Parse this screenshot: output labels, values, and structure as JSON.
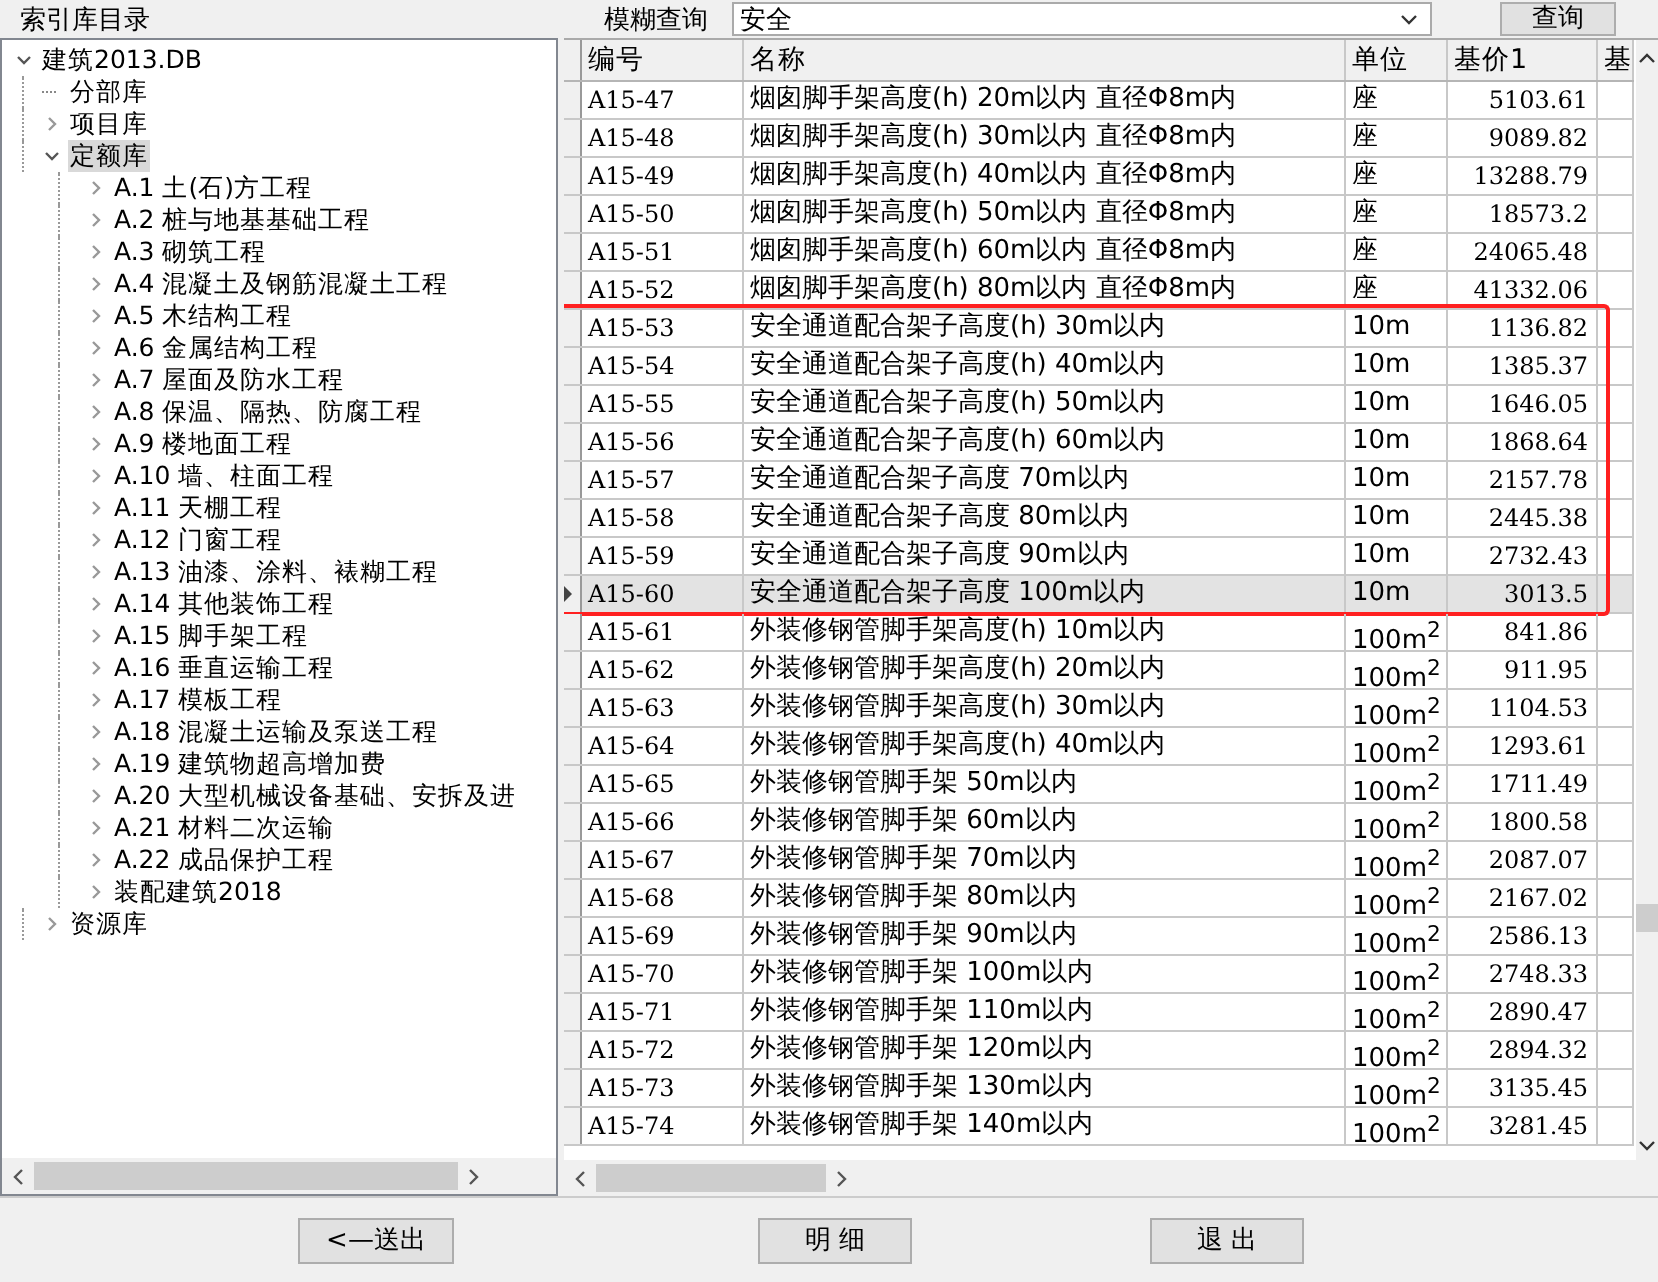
{
  "top_bar": {
    "panel_title": "索引库目录",
    "search_label": "模糊查询",
    "search_value": "安全",
    "search_button": "查询"
  },
  "tree": [
    {
      "label": "建筑2013.DB",
      "kind": "folder",
      "expanded": true,
      "selected": false,
      "children": [
        {
          "label": "分部库",
          "kind": "leaf",
          "selected": false
        },
        {
          "label": "项目库",
          "kind": "folder",
          "expanded": false,
          "selected": false
        },
        {
          "label": "定额库",
          "kind": "folder",
          "expanded": true,
          "selected": true,
          "children": [
            {
              "label": "A.1 土(石)方工程",
              "kind": "folder",
              "expanded": false,
              "selected": false
            },
            {
              "label": "A.2 桩与地基基础工程",
              "kind": "folder",
              "expanded": false,
              "selected": false
            },
            {
              "label": "A.3 砌筑工程",
              "kind": "folder",
              "expanded": false,
              "selected": false
            },
            {
              "label": "A.4 混凝土及钢筋混凝土工程",
              "kind": "folder",
              "expanded": false,
              "selected": false
            },
            {
              "label": "A.5 木结构工程",
              "kind": "folder",
              "expanded": false,
              "selected": false
            },
            {
              "label": "A.6 金属结构工程",
              "kind": "folder",
              "expanded": false,
              "selected": false
            },
            {
              "label": "A.7 屋面及防水工程",
              "kind": "folder",
              "expanded": false,
              "selected": false
            },
            {
              "label": "A.8 保温、隔热、防腐工程",
              "kind": "folder",
              "expanded": false,
              "selected": false
            },
            {
              "label": "A.9 楼地面工程",
              "kind": "folder",
              "expanded": false,
              "selected": false
            },
            {
              "label": "A.10 墙、柱面工程",
              "kind": "folder",
              "expanded": false,
              "selected": false
            },
            {
              "label": "A.11 天棚工程",
              "kind": "folder",
              "expanded": false,
              "selected": false
            },
            {
              "label": "A.12 门窗工程",
              "kind": "folder",
              "expanded": false,
              "selected": false
            },
            {
              "label": "A.13 油漆、涂料、裱糊工程",
              "kind": "folder",
              "expanded": false,
              "selected": false
            },
            {
              "label": "A.14 其他装饰工程",
              "kind": "folder",
              "expanded": false,
              "selected": false
            },
            {
              "label": "A.15 脚手架工程",
              "kind": "folder",
              "expanded": false,
              "selected": false
            },
            {
              "label": "A.16 垂直运输工程",
              "kind": "folder",
              "expanded": false,
              "selected": false
            },
            {
              "label": "A.17 模板工程",
              "kind": "folder",
              "expanded": false,
              "selected": false
            },
            {
              "label": "A.18 混凝土运输及泵送工程",
              "kind": "folder",
              "expanded": false,
              "selected": false
            },
            {
              "label": "A.19 建筑物超高增加费",
              "kind": "folder",
              "expanded": false,
              "selected": false
            },
            {
              "label": "A.20 大型机械设备基础、安拆及进",
              "kind": "folder",
              "expanded": false,
              "selected": false
            },
            {
              "label": "A.21 材料二次运输",
              "kind": "folder",
              "expanded": false,
              "selected": false
            },
            {
              "label": "A.22 成品保护工程",
              "kind": "folder",
              "expanded": false,
              "selected": false
            },
            {
              "label": "装配建筑2018",
              "kind": "folder",
              "expanded": false,
              "selected": false
            }
          ]
        },
        {
          "label": "资源库",
          "kind": "folder",
          "expanded": false,
          "selected": false
        }
      ]
    }
  ],
  "table": {
    "columns": [
      "编号",
      "名称",
      "单位",
      "基价1",
      "基"
    ],
    "rows": [
      {
        "code": "A15-47",
        "name": "烟囱脚手架高度(h) 20m以内 直径Φ8m内",
        "unit": "座",
        "price": "5103.61",
        "selected": false,
        "boxed": false
      },
      {
        "code": "A15-48",
        "name": "烟囱脚手架高度(h) 30m以内 直径Φ8m内",
        "unit": "座",
        "price": "9089.82",
        "selected": false,
        "boxed": false
      },
      {
        "code": "A15-49",
        "name": "烟囱脚手架高度(h) 40m以内 直径Φ8m内",
        "unit": "座",
        "price": "13288.79",
        "selected": false,
        "boxed": false
      },
      {
        "code": "A15-50",
        "name": "烟囱脚手架高度(h) 50m以内 直径Φ8m内",
        "unit": "座",
        "price": "18573.2",
        "selected": false,
        "boxed": false
      },
      {
        "code": "A15-51",
        "name": "烟囱脚手架高度(h) 60m以内 直径Φ8m内",
        "unit": "座",
        "price": "24065.48",
        "selected": false,
        "boxed": false
      },
      {
        "code": "A15-52",
        "name": "烟囱脚手架高度(h) 80m以内 直径Φ8m内",
        "unit": "座",
        "price": "41332.06",
        "selected": false,
        "boxed": false
      },
      {
        "code": "A15-53",
        "name": "安全通道配合架子高度(h) 30m以内",
        "unit": "10m",
        "price": "1136.82",
        "selected": false,
        "boxed": true
      },
      {
        "code": "A15-54",
        "name": "安全通道配合架子高度(h) 40m以内",
        "unit": "10m",
        "price": "1385.37",
        "selected": false,
        "boxed": true
      },
      {
        "code": "A15-55",
        "name": "安全通道配合架子高度(h) 50m以内",
        "unit": "10m",
        "price": "1646.05",
        "selected": false,
        "boxed": true
      },
      {
        "code": "A15-56",
        "name": "安全通道配合架子高度(h) 60m以内",
        "unit": "10m",
        "price": "1868.64",
        "selected": false,
        "boxed": true
      },
      {
        "code": "A15-57",
        "name": "安全通道配合架子高度 70m以内",
        "unit": "10m",
        "price": "2157.78",
        "selected": false,
        "boxed": true
      },
      {
        "code": "A15-58",
        "name": "安全通道配合架子高度 80m以内",
        "unit": "10m",
        "price": "2445.38",
        "selected": false,
        "boxed": true
      },
      {
        "code": "A15-59",
        "name": "安全通道配合架子高度 90m以内",
        "unit": "10m",
        "price": "2732.43",
        "selected": false,
        "boxed": true
      },
      {
        "code": "A15-60",
        "name": "安全通道配合架子高度 100m以内",
        "unit": "10m",
        "price": "3013.5",
        "selected": true,
        "boxed": true
      },
      {
        "code": "A15-61",
        "name": "外装修钢管脚手架高度(h) 10m以内",
        "unit": "100m$^{2}$",
        "price": "841.86",
        "selected": false,
        "boxed": false
      },
      {
        "code": "A15-62",
        "name": "外装修钢管脚手架高度(h) 20m以内",
        "unit": "100m$^{2}$",
        "price": "911.95",
        "selected": false,
        "boxed": false
      },
      {
        "code": "A15-63",
        "name": "外装修钢管脚手架高度(h) 30m以内",
        "unit": "100m$^{2}$",
        "price": "1104.53",
        "selected": false,
        "boxed": false
      },
      {
        "code": "A15-64",
        "name": "外装修钢管脚手架高度(h) 40m以内",
        "unit": "100m$^{2}$",
        "price": "1293.61",
        "selected": false,
        "boxed": false
      },
      {
        "code": "A15-65",
        "name": "外装修钢管脚手架 50m以内",
        "unit": "100m$^{2}$",
        "price": "1711.49",
        "selected": false,
        "boxed": false
      },
      {
        "code": "A15-66",
        "name": "外装修钢管脚手架 60m以内",
        "unit": "100m$^{2}$",
        "price": "1800.58",
        "selected": false,
        "boxed": false
      },
      {
        "code": "A15-67",
        "name": "外装修钢管脚手架 70m以内",
        "unit": "100m$^{2}$",
        "price": "2087.07",
        "selected": false,
        "boxed": false
      },
      {
        "code": "A15-68",
        "name": "外装修钢管脚手架 80m以内",
        "unit": "100m$^{2}$",
        "price": "2167.02",
        "selected": false,
        "boxed": false
      },
      {
        "code": "A15-69",
        "name": "外装修钢管脚手架 90m以内",
        "unit": "100m$^{2}$",
        "price": "2586.13",
        "selected": false,
        "boxed": false
      },
      {
        "code": "A15-70",
        "name": "外装修钢管脚手架 100m以内",
        "unit": "100m$^{2}$",
        "price": "2748.33",
        "selected": false,
        "boxed": false
      },
      {
        "code": "A15-71",
        "name": "外装修钢管脚手架 110m以内",
        "unit": "100m$^{2}$",
        "price": "2890.47",
        "selected": false,
        "boxed": false
      },
      {
        "code": "A15-72",
        "name": "外装修钢管脚手架 120m以内",
        "unit": "100m$^{2}$",
        "price": "2894.32",
        "selected": false,
        "boxed": false
      },
      {
        "code": "A15-73",
        "name": "外装修钢管脚手架 130m以内",
        "unit": "100m$^{2}$",
        "price": "3135.45",
        "selected": false,
        "boxed": false
      },
      {
        "code": "A15-74",
        "name": "外装修钢管脚手架 140m以内",
        "unit": "100m$^{2}$",
        "price": "3281.45",
        "selected": false,
        "boxed": false
      }
    ]
  },
  "buttons": [
    "<—送出",
    "明 细",
    "退 出"
  ]
}
